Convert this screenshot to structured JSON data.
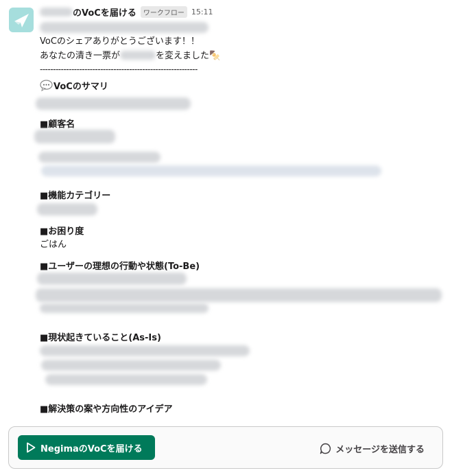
{
  "message": {
    "sender_suffix": "のVoCを届ける",
    "badge": "ワークフロー",
    "time": "15:11",
    "line1": "VoCのシェアありがとうございます！！",
    "line2_prefix": "あなたの清き一票が",
    "line2_suffix": "を変えました",
    "line2_emoji": "🍢",
    "divider": "------------------------------------------------------------",
    "sections": {
      "summary": "VoCのサマリ",
      "customer": "■顧客名",
      "category": "■機能カテゴリー",
      "trouble": "■お困り度",
      "trouble_value": "ごはん",
      "tobe": "■ユーザーの理想の行動や状態(To-Be)",
      "asis": "■現状起きていること(As-Is)",
      "solution": "■解決策の案や方向性のアイデア"
    }
  },
  "composer": {
    "workflow_button": "NegimaのVoCを届ける",
    "send_message": "メッセージを送信する"
  },
  "colors": {
    "accent": "#007a5a",
    "avatar_bg": "#a6dedd"
  }
}
